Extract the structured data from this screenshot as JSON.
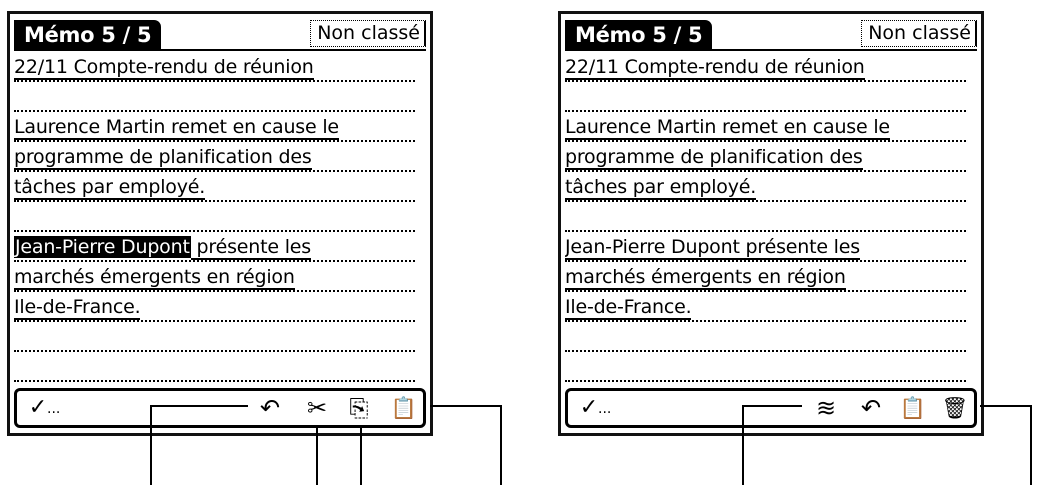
{
  "screen_left": {
    "title": "Mémo 5 / 5",
    "category": "Non classé",
    "memo_lines": [
      {
        "text": "22/11 Compte-rendu de réunion"
      },
      {
        "text": ""
      },
      {
        "text": "Laurence Martin remet en cause  le"
      },
      {
        "text": "programme de planification des"
      },
      {
        "text": "tâches par employé."
      },
      {
        "text": ""
      },
      {
        "highlight": "Jean-Pierre Dupont",
        "text": " présente les"
      },
      {
        "text": "marchés émergents en région"
      },
      {
        "text": "Ile-de-France."
      },
      {
        "text": ""
      },
      {
        "text": ""
      }
    ],
    "toolbar": {
      "check_glyph": "✓",
      "dots": "...",
      "undo_glyph": "↶",
      "cut_glyph": "✂",
      "copy_glyph": "⎘",
      "paste_glyph": "📋"
    }
  },
  "screen_right": {
    "title": "Mémo 5 / 5",
    "category": "Non classé",
    "memo_lines": [
      {
        "text": "22/11 Compte-rendu de réunion"
      },
      {
        "text": ""
      },
      {
        "text": "Laurence Martin remet en cause  le"
      },
      {
        "text": "programme de planification des"
      },
      {
        "text": "tâches par employé."
      },
      {
        "text": ""
      },
      {
        "text": "Jean-Pierre Dupont présente les"
      },
      {
        "text": "marchés émergents en région"
      },
      {
        "text": "Ile-de-France."
      },
      {
        "text": ""
      },
      {
        "text": ""
      }
    ],
    "toolbar": {
      "check_glyph": "✓",
      "dots": "...",
      "beam_glyph": "≋",
      "undo_glyph": "↶",
      "paste_glyph": "📋",
      "delete_glyph": "🗑"
    }
  }
}
